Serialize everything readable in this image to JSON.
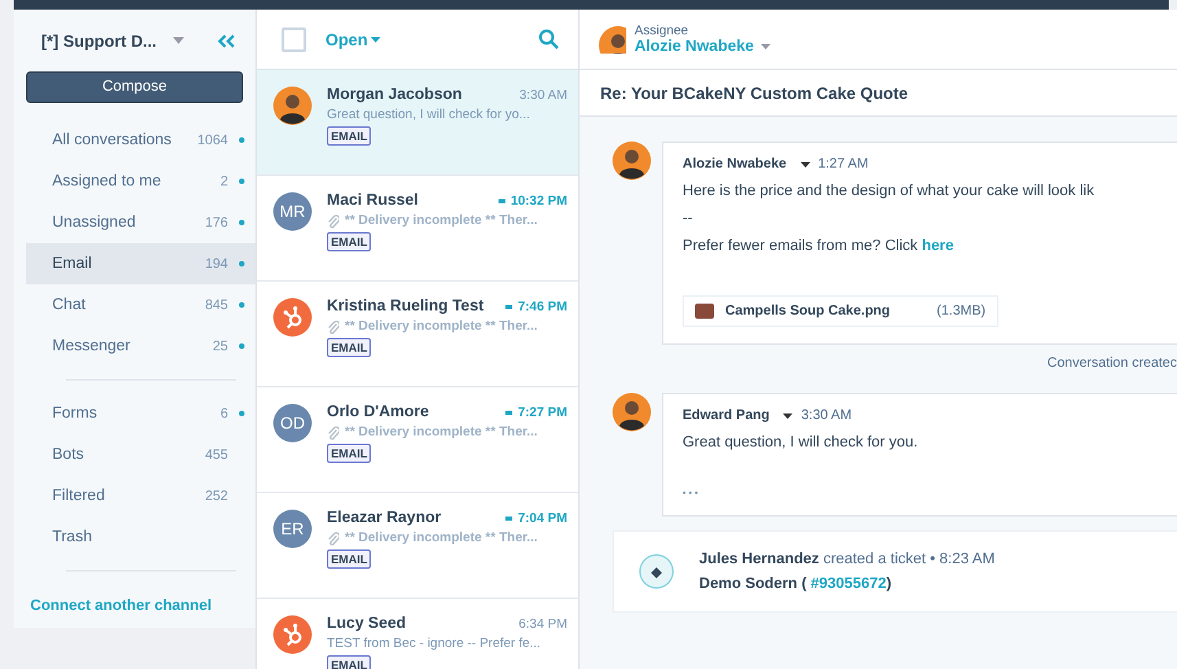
{
  "sidebar": {
    "inbox": "[*] Support D...",
    "compose": "Compose",
    "groups": [
      [
        {
          "label": "All conversations",
          "count": "1064",
          "dot": true,
          "selected": false
        },
        {
          "label": "Assigned to me",
          "count": "2",
          "dot": true,
          "selected": false
        },
        {
          "label": "Unassigned",
          "count": "176",
          "dot": true,
          "selected": false
        },
        {
          "label": "Email",
          "count": "194",
          "dot": true,
          "selected": true
        },
        {
          "label": "Chat",
          "count": "845",
          "dot": true,
          "selected": false
        },
        {
          "label": "Messenger",
          "count": "25",
          "dot": true,
          "selected": false
        }
      ],
      [
        {
          "label": "Forms",
          "count": "6",
          "dot": true,
          "selected": false
        },
        {
          "label": "Bots",
          "count": "455",
          "dot": false,
          "selected": false
        },
        {
          "label": "Filtered",
          "count": "252",
          "dot": false,
          "selected": false
        },
        {
          "label": "Trash",
          "dot": false,
          "selected": false
        }
      ]
    ],
    "connect": "Connect another channel"
  },
  "list": {
    "filter": "Open",
    "checked": false,
    "rows": [
      {
        "kind": "photo",
        "name": "Morgan Jacobson",
        "time": "3:30 AM",
        "unread": false,
        "attachment": false,
        "preview": "Great question, I will check for yo...",
        "tag": "EMAIL",
        "selected": true
      },
      {
        "kind": "initials",
        "initials": "MR",
        "name": "Maci Russel",
        "time": "10:32 PM",
        "unread": true,
        "attachment": true,
        "preview": "** Delivery incomplete ** Ther...",
        "tag": "EMAIL",
        "selected": false
      },
      {
        "kind": "logo",
        "name": "Kristina Rueling Test",
        "time": "7:46 PM",
        "unread": true,
        "attachment": true,
        "preview": "** Delivery incomplete ** Ther...",
        "tag": "EMAIL",
        "selected": false
      },
      {
        "kind": "initials",
        "initials": "OD",
        "name": "Orlo D'Amore",
        "time": "7:27 PM",
        "unread": true,
        "attachment": true,
        "preview": "** Delivery incomplete ** Ther...",
        "tag": "EMAIL",
        "selected": false
      },
      {
        "kind": "initials",
        "initials": "ER",
        "name": "Eleazar Raynor",
        "time": "7:04 PM",
        "unread": true,
        "attachment": true,
        "preview": "** Delivery incomplete ** Ther...",
        "tag": "EMAIL",
        "selected": false
      },
      {
        "kind": "logo",
        "name": "Lucy Seed",
        "time": "6:34 PM",
        "unread": false,
        "attachment": false,
        "preview": "TEST from Bec - ignore -- Prefer fe...",
        "tag": "EMAIL",
        "selected": false
      }
    ]
  },
  "thread": {
    "assignee_label": "Assignee",
    "assignee": "Alozie Nwabeke",
    "subject": "Re: Your BCakeNY Custom Cake Quote",
    "items": [
      {
        "kind": "email",
        "author": "Alozie Nwabeke",
        "time": "1:27 AM",
        "lines": [
          {
            "text": "Here is the price and the design of what your cake will look lik"
          },
          {
            "text": "--"
          },
          {
            "text": "Prefer fewer emails from me? Click",
            "link": "here"
          }
        ],
        "attachment": {
          "name": "Campells Soup Cake.png",
          "size": "(1.3MB)"
        }
      },
      {
        "kind": "note",
        "text": "Conversation createc"
      },
      {
        "kind": "email",
        "author": "Edward Pang",
        "time": "3:30 AM",
        "lines": [
          {
            "text": "Great question, I will check for you."
          }
        ],
        "more": "• • •"
      },
      {
        "kind": "ticket",
        "author": "Jules Hernandez",
        "action": "created a ticket • 8:23 AM",
        "title": "Demo Sodern (",
        "ticket_id": "#93055672",
        "close": ")"
      }
    ]
  }
}
